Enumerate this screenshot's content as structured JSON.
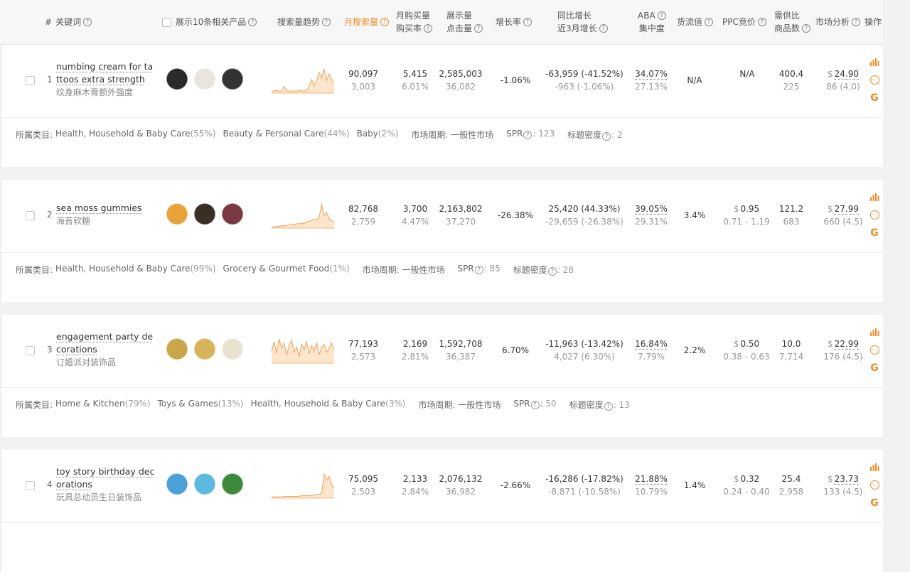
{
  "header": {
    "index_label": "#",
    "keyword": "关键词",
    "show_products": "展示10条相关产品",
    "trend": "搜索量趋势",
    "monthly_search": "月搜索量",
    "monthly_buy_1": "月购买量",
    "monthly_buy_2": "购买率",
    "impressions_1": "展示量",
    "impressions_2": "点击量",
    "growth": "增长率",
    "yoy_1": "同比增长",
    "yoy_2": "近3月增长",
    "aba_1": "ABA",
    "aba_2": "集中度",
    "flow": "货流值",
    "ppc": "PPC竞价",
    "supply_1": "需供比",
    "supply_2": "商品数",
    "market": "市场分析",
    "ops": "操作"
  },
  "category_label": "所属类目:",
  "market_cycle_label": "市场周期:",
  "spr_label": "SPR",
  "title_density_label": "标题密度",
  "rows": [
    {
      "index": "1",
      "keyword": "numbing cream for tattoos extra strength",
      "keyword_cn": "纹身麻木膏额外强度",
      "search": "90,097",
      "search_sub": "3,003",
      "buy": "5,415",
      "buy_rate": "6.01%",
      "impr": "2,585,003",
      "clicks": "36,082",
      "growth": "-1.06%",
      "yoy": "-63,959 (-41.52%)",
      "m3": "-963 (-1.06%)",
      "aba": "34.07%",
      "aba_sub": "27.13%",
      "flow": "N/A",
      "ppc_cur": "",
      "ppc": "N/A",
      "ppc_range": "",
      "supply": "400.4",
      "products": "225",
      "price_cur": "$",
      "price": "24.90",
      "reviews": "86 (4.0)",
      "cats": [
        {
          "name": "Health, Household & Baby Care",
          "pct": "(55%)"
        },
        {
          "name": "Beauty & Personal Care",
          "pct": "(44%)"
        },
        {
          "name": "Baby",
          "pct": "(2%)"
        }
      ],
      "cycle": "一般性市场",
      "spr": "123",
      "density": "2",
      "spark": [
        3,
        3,
        4,
        3,
        3,
        10,
        4,
        3,
        3,
        3,
        3,
        4,
        3,
        3,
        4,
        10,
        20,
        10,
        18,
        30,
        22,
        35,
        18,
        28,
        20,
        14
      ],
      "thumbs": [
        "#2a2a2a",
        "#e9e4dc",
        "#333333"
      ]
    },
    {
      "index": "2",
      "keyword": "sea moss gummies",
      "keyword_cn": "海苔软糖",
      "search": "82,768",
      "search_sub": "2,759",
      "buy": "3,700",
      "buy_rate": "4.47%",
      "impr": "2,163,802",
      "clicks": "37,270",
      "growth": "-26.38%",
      "yoy": "25,420 (44.33%)",
      "m3": "-29,659 (-26.38%)",
      "aba": "39.05%",
      "aba_sub": "29.31%",
      "flow": "3.4%",
      "ppc_cur": "$",
      "ppc": "0.95",
      "ppc_range": "0.71 - 1.19",
      "supply": "121.2",
      "products": "683",
      "price_cur": "$",
      "price": "27.99",
      "reviews": "660 (4.5)",
      "cats": [
        {
          "name": "Health, Household & Baby Care",
          "pct": "(99%)"
        },
        {
          "name": "Grocery & Gourmet Food",
          "pct": "(1%)"
        }
      ],
      "cycle": "一般性市场",
      "spr": "85",
      "density": "28",
      "spark": [
        2,
        2,
        3,
        3,
        4,
        4,
        5,
        5,
        6,
        6,
        7,
        7,
        8,
        8,
        10,
        11,
        13,
        15,
        14,
        18,
        40,
        20,
        26,
        16,
        12,
        10
      ],
      "thumbs": [
        "#e8a23a",
        "#3a2e25",
        "#7a3a42"
      ]
    },
    {
      "index": "3",
      "keyword": "engagement party decorations",
      "keyword_cn": "订婚派对装饰品",
      "search": "77,193",
      "search_sub": "2,573",
      "buy": "2,169",
      "buy_rate": "2.81%",
      "impr": "1,592,708",
      "clicks": "36,387",
      "growth": "6.70%",
      "yoy": "-11,963 (-13.42%)",
      "m3": "4,027 (6.30%)",
      "aba": "16.84%",
      "aba_sub": "7.79%",
      "flow": "2.2%",
      "ppc_cur": "$",
      "ppc": "0.50",
      "ppc_range": "0.38 - 0.63",
      "supply": "10.0",
      "products": "7,714",
      "price_cur": "$",
      "price": "22.99",
      "reviews": "176 (4.5)",
      "cats": [
        {
          "name": "Home & Kitchen",
          "pct": "(79%)"
        },
        {
          "name": "Toys & Games",
          "pct": "(13%)"
        },
        {
          "name": "Health, Household & Baby Care",
          "pct": "(3%)"
        }
      ],
      "cycle": "一般性市场",
      "spr": "50",
      "density": "13",
      "spark": [
        18,
        32,
        14,
        36,
        22,
        30,
        12,
        26,
        34,
        16,
        24,
        10,
        28,
        20,
        32,
        14,
        26,
        18,
        30,
        12,
        24,
        28,
        16,
        22,
        30,
        20
      ],
      "thumbs": [
        "#c9a64a",
        "#d7b45a",
        "#e8e2d0"
      ]
    },
    {
      "index": "4",
      "keyword": "toy story birthday decorations",
      "keyword_cn": "玩具总动员生日装饰品",
      "search": "75,095",
      "search_sub": "2,503",
      "buy": "2,133",
      "buy_rate": "2.84%",
      "impr": "2,076,132",
      "clicks": "36,982",
      "growth": "-2.66%",
      "yoy": "-16,286 (-17.82%)",
      "m3": "-8,871 (-10.58%)",
      "aba": "21.88%",
      "aba_sub": "10.79%",
      "flow": "1.4%",
      "ppc_cur": "$",
      "ppc": "0.32",
      "ppc_range": "0.24 - 0.40",
      "supply": "25.4",
      "products": "2,958",
      "price_cur": "$",
      "price": "23.73",
      "reviews": "133 (4.5)",
      "cats": [],
      "cycle": "",
      "spr": "",
      "density": "",
      "spark": [
        2,
        2,
        2,
        2,
        2,
        3,
        3,
        3,
        3,
        3,
        3,
        3,
        4,
        4,
        4,
        4,
        5,
        5,
        6,
        6,
        8,
        40,
        30,
        36,
        22,
        18
      ],
      "thumbs": [
        "#4aa0d8",
        "#5db9e0",
        "#3c8a3a"
      ]
    }
  ]
}
